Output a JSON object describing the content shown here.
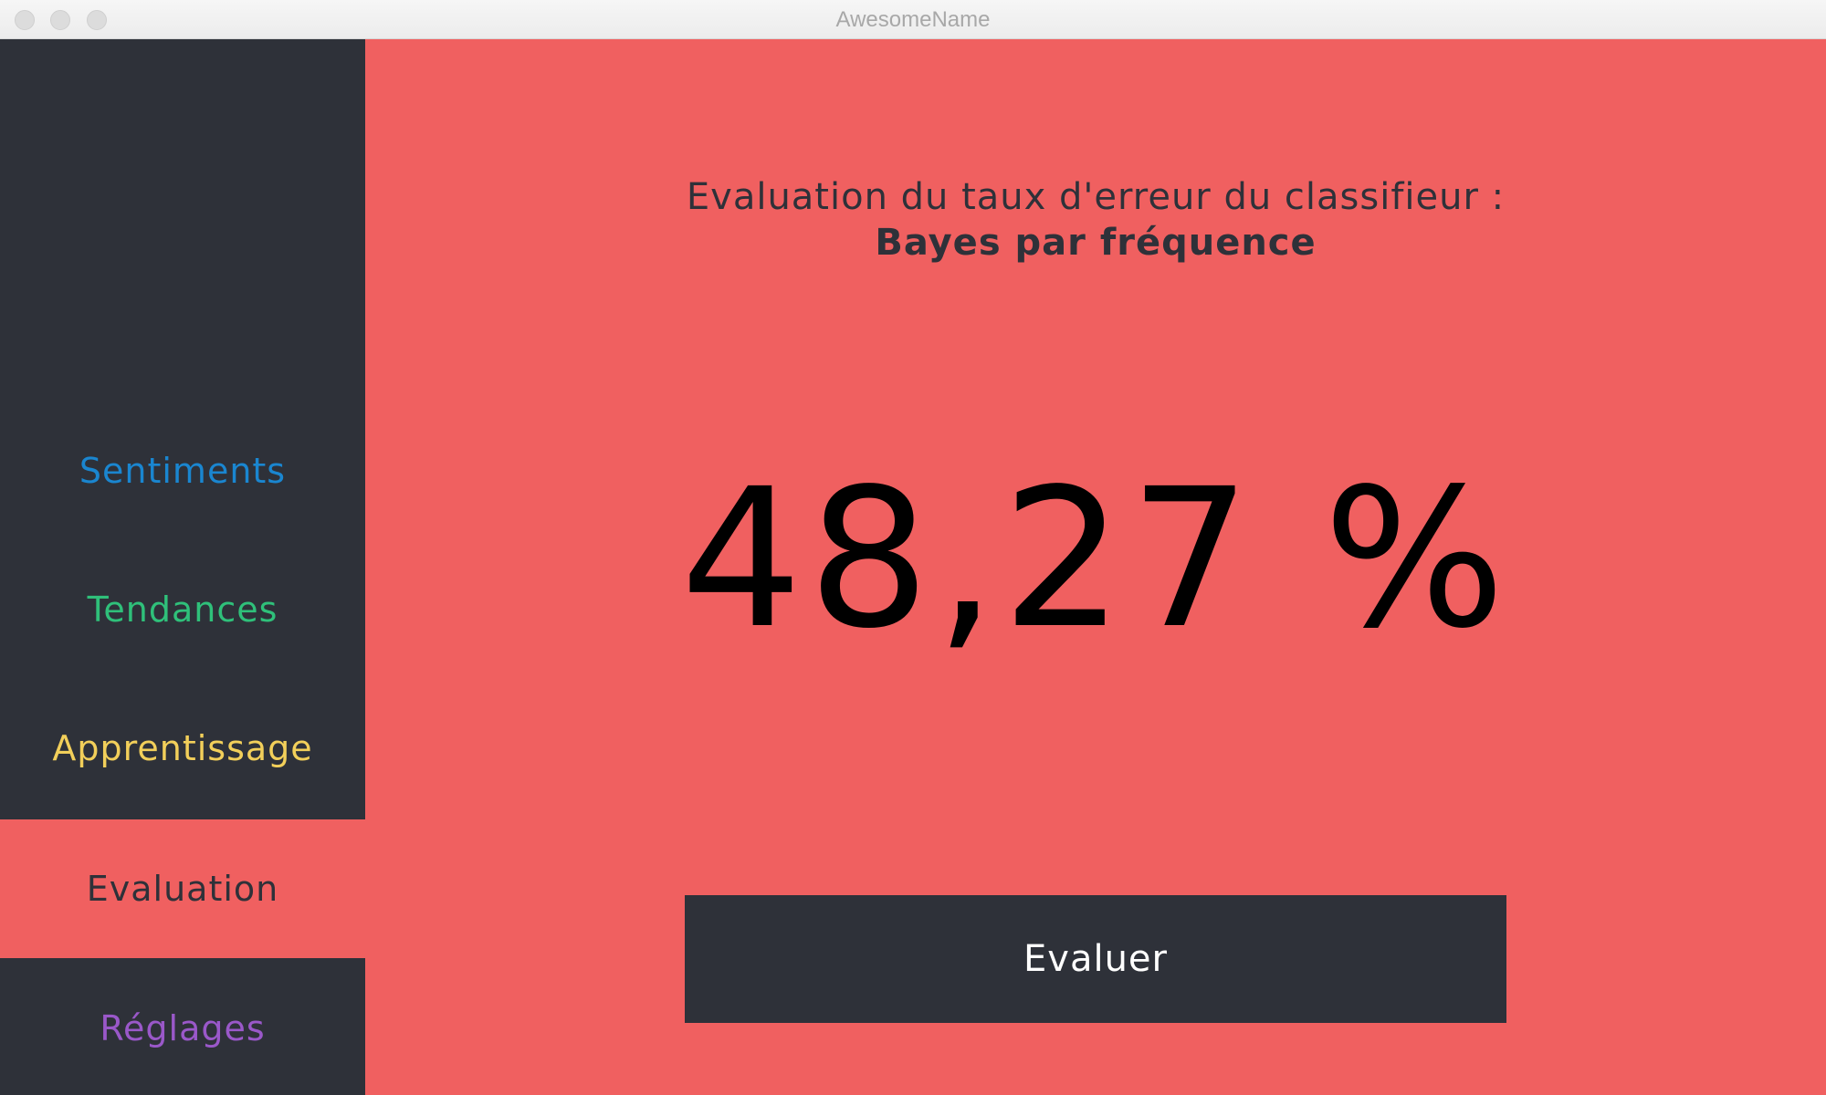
{
  "window": {
    "title": "AwesomeName"
  },
  "colors": {
    "accent": "#f06060",
    "sidebar_bg": "#2e3139",
    "sentiments": "#1a86d0",
    "tendances": "#2fc07a",
    "apprentissage": "#f2cf5a",
    "evaluation": "#2e3139",
    "reglages": "#9a58c9"
  },
  "sidebar": {
    "items": [
      {
        "label": "Sentiments",
        "active": false
      },
      {
        "label": "Tendances",
        "active": false
      },
      {
        "label": "Apprentissage",
        "active": false
      },
      {
        "label": "Evaluation",
        "active": true
      },
      {
        "label": "Réglages",
        "active": false
      }
    ]
  },
  "main": {
    "heading_line1": "Evaluation du taux d'erreur du classifieur :",
    "heading_line2": "Bayes par fréquence",
    "error_rate": "48,27 %",
    "button_label": "Evaluer"
  }
}
